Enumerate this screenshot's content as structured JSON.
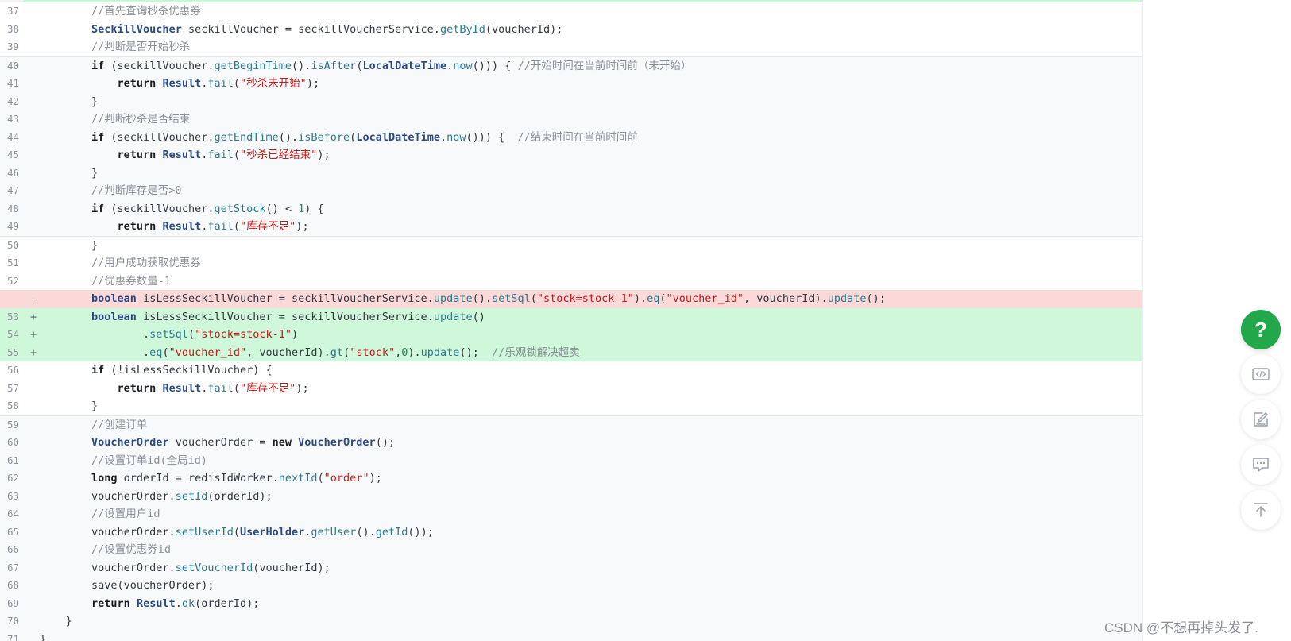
{
  "code_lines": [
    {
      "num": "37",
      "mark": "",
      "kind": "ctx-white",
      "code": [
        [
          "cm",
          "        //首先查询秒杀优惠券"
        ]
      ]
    },
    {
      "num": "38",
      "mark": "",
      "kind": "ctx-white",
      "code": [
        [
          "",
          "        "
        ],
        [
          "ty",
          "SeckillVoucher"
        ],
        [
          "",
          " seckillVoucher = seckillVoucherService."
        ],
        [
          "fn",
          "getById"
        ],
        [
          "",
          "(voucherId);"
        ]
      ]
    },
    {
      "num": "39",
      "mark": "",
      "kind": "ctx-white",
      "code": [
        [
          "cm",
          "        //判断是否开始秒杀"
        ]
      ]
    },
    {
      "num": "40",
      "mark": "",
      "kind": "ctx-gray sep-top",
      "code": [
        [
          "",
          "        "
        ],
        [
          "kw",
          "if"
        ],
        [
          "",
          " (seckillVoucher."
        ],
        [
          "fn",
          "getBeginTime"
        ],
        [
          "",
          "()."
        ],
        [
          "fn",
          "isAfter"
        ],
        [
          "",
          "("
        ],
        [
          "ty",
          "LocalDateTime"
        ],
        [
          "",
          "."
        ],
        [
          "fn",
          "now"
        ],
        [
          "",
          "())) { "
        ],
        [
          "cm",
          "//开始时间在当前时间前（未开始）"
        ]
      ]
    },
    {
      "num": "41",
      "mark": "",
      "kind": "ctx-gray",
      "code": [
        [
          "",
          "            "
        ],
        [
          "kw",
          "return"
        ],
        [
          "",
          " "
        ],
        [
          "ty",
          "Result"
        ],
        [
          "",
          "."
        ],
        [
          "fn",
          "fail"
        ],
        [
          "",
          "("
        ],
        [
          "str",
          "\"秒杀未开始\""
        ],
        [
          "",
          ");"
        ]
      ]
    },
    {
      "num": "42",
      "mark": "",
      "kind": "ctx-gray",
      "code": [
        [
          "",
          "        }"
        ]
      ]
    },
    {
      "num": "43",
      "mark": "",
      "kind": "ctx-gray",
      "code": [
        [
          "cm",
          "        //判断秒杀是否结束"
        ]
      ]
    },
    {
      "num": "44",
      "mark": "",
      "kind": "ctx-gray",
      "code": [
        [
          "",
          "        "
        ],
        [
          "kw",
          "if"
        ],
        [
          "",
          " (seckillVoucher."
        ],
        [
          "fn",
          "getEndTime"
        ],
        [
          "",
          "()."
        ],
        [
          "fn",
          "isBefore"
        ],
        [
          "",
          "("
        ],
        [
          "ty",
          "LocalDateTime"
        ],
        [
          "",
          "."
        ],
        [
          "fn",
          "now"
        ],
        [
          "",
          "())) {  "
        ],
        [
          "cm",
          "//结束时间在当前时间前"
        ]
      ]
    },
    {
      "num": "45",
      "mark": "",
      "kind": "ctx-gray",
      "code": [
        [
          "",
          "            "
        ],
        [
          "kw",
          "return"
        ],
        [
          "",
          " "
        ],
        [
          "ty",
          "Result"
        ],
        [
          "",
          "."
        ],
        [
          "fn",
          "fail"
        ],
        [
          "",
          "("
        ],
        [
          "str",
          "\"秒杀已经结束\""
        ],
        [
          "",
          ");"
        ]
      ]
    },
    {
      "num": "46",
      "mark": "",
      "kind": "ctx-gray",
      "code": [
        [
          "",
          "        }"
        ]
      ]
    },
    {
      "num": "47",
      "mark": "",
      "kind": "ctx-gray",
      "code": [
        [
          "cm",
          "        //判断库存是否>0"
        ]
      ]
    },
    {
      "num": "48",
      "mark": "",
      "kind": "ctx-gray",
      "code": [
        [
          "",
          "        "
        ],
        [
          "kw",
          "if"
        ],
        [
          "",
          " (seckillVoucher."
        ],
        [
          "fn",
          "getStock"
        ],
        [
          "",
          "() < "
        ],
        [
          "num",
          "1"
        ],
        [
          "",
          ") {"
        ]
      ]
    },
    {
      "num": "49",
      "mark": "",
      "kind": "ctx-gray",
      "code": [
        [
          "",
          "            "
        ],
        [
          "kw",
          "return"
        ],
        [
          "",
          " "
        ],
        [
          "ty",
          "Result"
        ],
        [
          "",
          "."
        ],
        [
          "fn",
          "fail"
        ],
        [
          "",
          "("
        ],
        [
          "str",
          "\"库存不足\""
        ],
        [
          "",
          ");"
        ]
      ]
    },
    {
      "num": "50",
      "mark": "",
      "kind": "ctx-white sep-top",
      "code": [
        [
          "",
          "        }"
        ]
      ]
    },
    {
      "num": "51",
      "mark": "",
      "kind": "ctx-white",
      "code": [
        [
          "cm",
          "        //用户成功获取优惠券"
        ]
      ]
    },
    {
      "num": "52",
      "mark": "",
      "kind": "ctx-white",
      "code": [
        [
          "cm",
          "        //优惠券数量-1"
        ]
      ]
    },
    {
      "num": "",
      "mark": "-",
      "kind": "del",
      "code": [
        [
          "",
          "        "
        ],
        [
          "ty",
          "boolean"
        ],
        [
          "",
          " isLessSeckillVoucher = seckillVoucherService."
        ],
        [
          "fn",
          "update"
        ],
        [
          "",
          "()."
        ],
        [
          "fn",
          "setSql"
        ],
        [
          "",
          "("
        ],
        [
          "str",
          "\"stock=stock-1\""
        ],
        [
          "",
          ")."
        ],
        [
          "fn",
          "eq"
        ],
        [
          "",
          "("
        ],
        [
          "str",
          "\"voucher_id\""
        ],
        [
          "",
          ", voucherId)."
        ],
        [
          "fn",
          "update"
        ],
        [
          "",
          "();"
        ]
      ]
    },
    {
      "num": "53",
      "mark": "+",
      "kind": "add",
      "code": [
        [
          "",
          "        "
        ],
        [
          "ty",
          "boolean"
        ],
        [
          "",
          " isLessSeckillVoucher = seckillVoucherService."
        ],
        [
          "fn",
          "update"
        ],
        [
          "",
          "()"
        ]
      ]
    },
    {
      "num": "54",
      "mark": "+",
      "kind": "add",
      "code": [
        [
          "",
          "                ."
        ],
        [
          "fn",
          "setSql"
        ],
        [
          "",
          "("
        ],
        [
          "str",
          "\"stock=stock-1\""
        ],
        [
          "",
          ")"
        ]
      ]
    },
    {
      "num": "55",
      "mark": "+",
      "kind": "add",
      "code": [
        [
          "",
          "                ."
        ],
        [
          "fn",
          "eq"
        ],
        [
          "",
          "("
        ],
        [
          "str",
          "\"voucher_id\""
        ],
        [
          "",
          ", voucherId)."
        ],
        [
          "fn",
          "gt"
        ],
        [
          "",
          "("
        ],
        [
          "str",
          "\"stock\""
        ],
        [
          "",
          ","
        ],
        [
          "num",
          "0"
        ],
        [
          "",
          ")."
        ],
        [
          "fn",
          "update"
        ],
        [
          "",
          "();  "
        ],
        [
          "cm",
          "//乐观锁解决超卖"
        ]
      ]
    },
    {
      "num": "56",
      "mark": "",
      "kind": "ctx-white",
      "code": [
        [
          "",
          "        "
        ],
        [
          "kw",
          "if"
        ],
        [
          "",
          " (!isLessSeckillVoucher) {"
        ]
      ]
    },
    {
      "num": "57",
      "mark": "",
      "kind": "ctx-white",
      "code": [
        [
          "",
          "            "
        ],
        [
          "kw",
          "return"
        ],
        [
          "",
          " "
        ],
        [
          "ty",
          "Result"
        ],
        [
          "",
          "."
        ],
        [
          "fn",
          "fail"
        ],
        [
          "",
          "("
        ],
        [
          "str",
          "\"库存不足\""
        ],
        [
          "",
          ");"
        ]
      ]
    },
    {
      "num": "58",
      "mark": "",
      "kind": "ctx-white",
      "code": [
        [
          "",
          "        }"
        ]
      ]
    },
    {
      "num": "59",
      "mark": "",
      "kind": "ctx-gray sep-top",
      "code": [
        [
          "cm",
          "        //创建订单"
        ]
      ]
    },
    {
      "num": "60",
      "mark": "",
      "kind": "ctx-gray",
      "code": [
        [
          "",
          "        "
        ],
        [
          "ty",
          "VoucherOrder"
        ],
        [
          "",
          " voucherOrder = "
        ],
        [
          "kw",
          "new"
        ],
        [
          "",
          " "
        ],
        [
          "ty",
          "VoucherOrder"
        ],
        [
          "",
          "();"
        ]
      ]
    },
    {
      "num": "61",
      "mark": "",
      "kind": "ctx-gray",
      "code": [
        [
          "cm",
          "        //设置订单id(全局id)"
        ]
      ]
    },
    {
      "num": "62",
      "mark": "",
      "kind": "ctx-gray",
      "code": [
        [
          "",
          "        "
        ],
        [
          "kw",
          "long"
        ],
        [
          "",
          " orderId = redisIdWorker."
        ],
        [
          "fn",
          "nextId"
        ],
        [
          "",
          "("
        ],
        [
          "str",
          "\"order\""
        ],
        [
          "",
          ");"
        ]
      ]
    },
    {
      "num": "63",
      "mark": "",
      "kind": "ctx-gray",
      "code": [
        [
          "",
          "        voucherOrder."
        ],
        [
          "fn",
          "setId"
        ],
        [
          "",
          "(orderId);"
        ]
      ]
    },
    {
      "num": "64",
      "mark": "",
      "kind": "ctx-gray",
      "code": [
        [
          "cm",
          "        //设置用户id"
        ]
      ]
    },
    {
      "num": "65",
      "mark": "",
      "kind": "ctx-gray",
      "code": [
        [
          "",
          "        voucherOrder."
        ],
        [
          "fn",
          "setUserId"
        ],
        [
          "",
          "("
        ],
        [
          "ty",
          "UserHolder"
        ],
        [
          "",
          "."
        ],
        [
          "fn",
          "getUser"
        ],
        [
          "",
          "()."
        ],
        [
          "fn",
          "getId"
        ],
        [
          "",
          "());"
        ]
      ]
    },
    {
      "num": "66",
      "mark": "",
      "kind": "ctx-gray",
      "code": [
        [
          "cm",
          "        //设置优惠券id"
        ]
      ]
    },
    {
      "num": "67",
      "mark": "",
      "kind": "ctx-gray",
      "code": [
        [
          "",
          "        voucherOrder."
        ],
        [
          "fn",
          "setVoucherId"
        ],
        [
          "",
          "(voucherId);"
        ]
      ]
    },
    {
      "num": "68",
      "mark": "",
      "kind": "ctx-gray",
      "code": [
        [
          "",
          "        save(voucherOrder);"
        ]
      ]
    },
    {
      "num": "69",
      "mark": "",
      "kind": "ctx-gray",
      "code": [
        [
          "",
          "        "
        ],
        [
          "kw",
          "return"
        ],
        [
          "",
          " "
        ],
        [
          "ty",
          "Result"
        ],
        [
          "",
          "."
        ],
        [
          "fn",
          "ok"
        ],
        [
          "",
          "(orderId);"
        ]
      ]
    },
    {
      "num": "70",
      "mark": "",
      "kind": "ctx-gray",
      "code": [
        [
          "",
          "    }"
        ]
      ]
    },
    {
      "num": "71",
      "mark": "",
      "kind": "ctx-gray",
      "code": [
        [
          "",
          "}"
        ]
      ]
    }
  ],
  "sidebar": {
    "help_label": "?",
    "code_icon": "code-icon",
    "edit_icon": "edit-icon",
    "comment_icon": "comment-icon",
    "top_icon": "back-to-top-icon"
  },
  "watermark": "CSDN @不想再掉头发了.",
  "colors": {
    "added_line": "#cff7da",
    "removed_line": "#fcd9d9",
    "help_button": "#22a84a"
  }
}
